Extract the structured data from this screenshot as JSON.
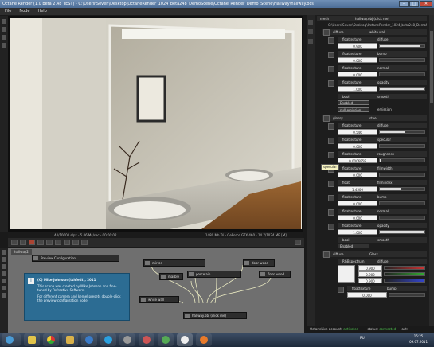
{
  "window": {
    "title": "Octane Render (1.0 beta 2.48 TEST) - C:\\Users\\Seven\\Desktop\\OctaneRender_1024_beta248_DemoScene\\Octane_Render_Demo_Scene\\Hallway\\hallway.ocs",
    "btn_min": "–",
    "btn_max": "□",
    "btn_close": "✕"
  },
  "menu": {
    "file": "File",
    "node": "Node",
    "help": "Help"
  },
  "render": {
    "status_left": "44/10000 s/px - 5.06 Ms/sec - 00:00:02",
    "status_right": "1480 Mb Tri - GeForce GTX 460 - 14.7/1024 MB [M]"
  },
  "graph": {
    "tab": "hallway2",
    "preview_config": "Preview Configuration",
    "nodes": {
      "mirror": "mirror",
      "porcelain": "porcelain",
      "marble": "marble",
      "door_wood": "door wood",
      "floor_wood": "floor wood",
      "white_wall": "white wall",
      "mesh": "hallway.obj (click me)"
    },
    "info": {
      "title": "(C) Mike Johnson (tshfedt), 2011",
      "line1": "This scene was created by Mike Johnson and fine-tuned by Refractive Software.",
      "line2": "For different camera and kernel presets double-click the preview configuration node."
    }
  },
  "inspector": {
    "top_label": "mesh",
    "top_value": "hallway.obj (click me)",
    "path": "C:\\Users\\Seven\\Desktop\\OctaneRender_1024_beta248_DemoScene\\...",
    "group1": {
      "type": "diffuse",
      "name": "white wall"
    },
    "g1_rows": [
      {
        "kind": "floattexture",
        "name": "diffuse",
        "value": "0.900",
        "fill": 0.9
      },
      {
        "kind": "floattexture",
        "name": "bump",
        "value": "0.000",
        "fill": 0
      },
      {
        "kind": "floattexture",
        "name": "normal",
        "value": "0.000",
        "fill": 0
      },
      {
        "kind": "floattexture",
        "name": "opacity",
        "value": "1.000",
        "fill": 1
      }
    ],
    "bool1": {
      "kind": "bool",
      "name": "smooth",
      "state": "Enabled"
    },
    "emission": {
      "kind": "null emission",
      "name": "emission"
    },
    "group2": {
      "type": "glossy",
      "name": "steel"
    },
    "g2_rows": [
      {
        "kind": "floattexture",
        "name": "diffuse",
        "value": "0.546",
        "fill": 0.55
      },
      {
        "kind": "floattexture",
        "name": "specular",
        "value": "0.000",
        "fill": 0
      },
      {
        "kind": "floattexture",
        "name": "roughness",
        "value": "0.0006958",
        "fill": 0.02
      },
      {
        "kind": "floattexture",
        "name": "filmwidth",
        "value": "0.000",
        "fill": 0
      },
      {
        "kind": "float",
        "name": "filmindex",
        "value": "1.4500",
        "fill": 0.48
      },
      {
        "kind": "floattexture",
        "name": "bump",
        "value": "0.000",
        "fill": 0
      },
      {
        "kind": "floattexture",
        "name": "normal",
        "value": "0.000",
        "fill": 0
      },
      {
        "kind": "floattexture",
        "name": "opacity",
        "value": "1.000",
        "fill": 1
      }
    ],
    "tooltip": "specular",
    "bool2": {
      "kind": "bool",
      "name": "smooth",
      "state": "Enabled"
    },
    "group3": {
      "type": "diffuse",
      "name": "Glass"
    },
    "rgb": {
      "kind": "RGBspectrum",
      "name": "diffuse",
      "r": "0.900",
      "g": "0.900",
      "b": "0.900"
    },
    "g3_rows": [
      {
        "kind": "floattexture",
        "name": "bump",
        "value": "0.000",
        "fill": 0
      }
    ]
  },
  "statusline": {
    "account_label": "OctaneLive account:",
    "account_state": "activated",
    "status_label": "status:",
    "status_value": "connected",
    "extra": "act:"
  },
  "taskbar": {
    "lang": "RU",
    "time": "15:25",
    "date": "09.07.2011"
  },
  "colors": {
    "accent": "#2c6c93",
    "connected": "#4ec24e",
    "wire": "#e8e8c0"
  }
}
